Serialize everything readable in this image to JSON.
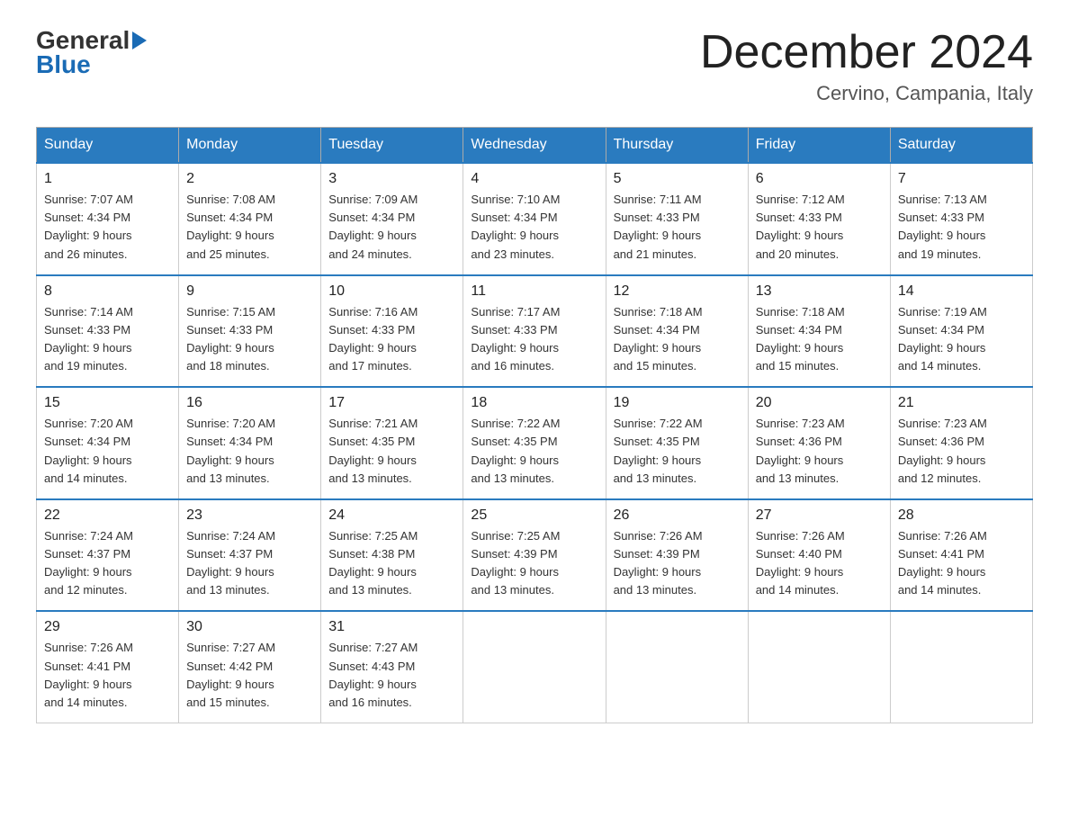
{
  "header": {
    "logo_general": "General",
    "logo_blue": "Blue",
    "month_title": "December 2024",
    "location": "Cervino, Campania, Italy"
  },
  "days_of_week": [
    "Sunday",
    "Monday",
    "Tuesday",
    "Wednesday",
    "Thursday",
    "Friday",
    "Saturday"
  ],
  "weeks": [
    [
      {
        "day": "1",
        "sunrise": "7:07 AM",
        "sunset": "4:34 PM",
        "daylight": "9 hours and 26 minutes."
      },
      {
        "day": "2",
        "sunrise": "7:08 AM",
        "sunset": "4:34 PM",
        "daylight": "9 hours and 25 minutes."
      },
      {
        "day": "3",
        "sunrise": "7:09 AM",
        "sunset": "4:34 PM",
        "daylight": "9 hours and 24 minutes."
      },
      {
        "day": "4",
        "sunrise": "7:10 AM",
        "sunset": "4:34 PM",
        "daylight": "9 hours and 23 minutes."
      },
      {
        "day": "5",
        "sunrise": "7:11 AM",
        "sunset": "4:33 PM",
        "daylight": "9 hours and 21 minutes."
      },
      {
        "day": "6",
        "sunrise": "7:12 AM",
        "sunset": "4:33 PM",
        "daylight": "9 hours and 20 minutes."
      },
      {
        "day": "7",
        "sunrise": "7:13 AM",
        "sunset": "4:33 PM",
        "daylight": "9 hours and 19 minutes."
      }
    ],
    [
      {
        "day": "8",
        "sunrise": "7:14 AM",
        "sunset": "4:33 PM",
        "daylight": "9 hours and 19 minutes."
      },
      {
        "day": "9",
        "sunrise": "7:15 AM",
        "sunset": "4:33 PM",
        "daylight": "9 hours and 18 minutes."
      },
      {
        "day": "10",
        "sunrise": "7:16 AM",
        "sunset": "4:33 PM",
        "daylight": "9 hours and 17 minutes."
      },
      {
        "day": "11",
        "sunrise": "7:17 AM",
        "sunset": "4:33 PM",
        "daylight": "9 hours and 16 minutes."
      },
      {
        "day": "12",
        "sunrise": "7:18 AM",
        "sunset": "4:34 PM",
        "daylight": "9 hours and 15 minutes."
      },
      {
        "day": "13",
        "sunrise": "7:18 AM",
        "sunset": "4:34 PM",
        "daylight": "9 hours and 15 minutes."
      },
      {
        "day": "14",
        "sunrise": "7:19 AM",
        "sunset": "4:34 PM",
        "daylight": "9 hours and 14 minutes."
      }
    ],
    [
      {
        "day": "15",
        "sunrise": "7:20 AM",
        "sunset": "4:34 PM",
        "daylight": "9 hours and 14 minutes."
      },
      {
        "day": "16",
        "sunrise": "7:20 AM",
        "sunset": "4:34 PM",
        "daylight": "9 hours and 13 minutes."
      },
      {
        "day": "17",
        "sunrise": "7:21 AM",
        "sunset": "4:35 PM",
        "daylight": "9 hours and 13 minutes."
      },
      {
        "day": "18",
        "sunrise": "7:22 AM",
        "sunset": "4:35 PM",
        "daylight": "9 hours and 13 minutes."
      },
      {
        "day": "19",
        "sunrise": "7:22 AM",
        "sunset": "4:35 PM",
        "daylight": "9 hours and 13 minutes."
      },
      {
        "day": "20",
        "sunrise": "7:23 AM",
        "sunset": "4:36 PM",
        "daylight": "9 hours and 13 minutes."
      },
      {
        "day": "21",
        "sunrise": "7:23 AM",
        "sunset": "4:36 PM",
        "daylight": "9 hours and 12 minutes."
      }
    ],
    [
      {
        "day": "22",
        "sunrise": "7:24 AM",
        "sunset": "4:37 PM",
        "daylight": "9 hours and 12 minutes."
      },
      {
        "day": "23",
        "sunrise": "7:24 AM",
        "sunset": "4:37 PM",
        "daylight": "9 hours and 13 minutes."
      },
      {
        "day": "24",
        "sunrise": "7:25 AM",
        "sunset": "4:38 PM",
        "daylight": "9 hours and 13 minutes."
      },
      {
        "day": "25",
        "sunrise": "7:25 AM",
        "sunset": "4:39 PM",
        "daylight": "9 hours and 13 minutes."
      },
      {
        "day": "26",
        "sunrise": "7:26 AM",
        "sunset": "4:39 PM",
        "daylight": "9 hours and 13 minutes."
      },
      {
        "day": "27",
        "sunrise": "7:26 AM",
        "sunset": "4:40 PM",
        "daylight": "9 hours and 14 minutes."
      },
      {
        "day": "28",
        "sunrise": "7:26 AM",
        "sunset": "4:41 PM",
        "daylight": "9 hours and 14 minutes."
      }
    ],
    [
      {
        "day": "29",
        "sunrise": "7:26 AM",
        "sunset": "4:41 PM",
        "daylight": "9 hours and 14 minutes."
      },
      {
        "day": "30",
        "sunrise": "7:27 AM",
        "sunset": "4:42 PM",
        "daylight": "9 hours and 15 minutes."
      },
      {
        "day": "31",
        "sunrise": "7:27 AM",
        "sunset": "4:43 PM",
        "daylight": "9 hours and 16 minutes."
      },
      null,
      null,
      null,
      null
    ]
  ],
  "labels": {
    "sunrise": "Sunrise:",
    "sunset": "Sunset:",
    "daylight": "Daylight:"
  }
}
